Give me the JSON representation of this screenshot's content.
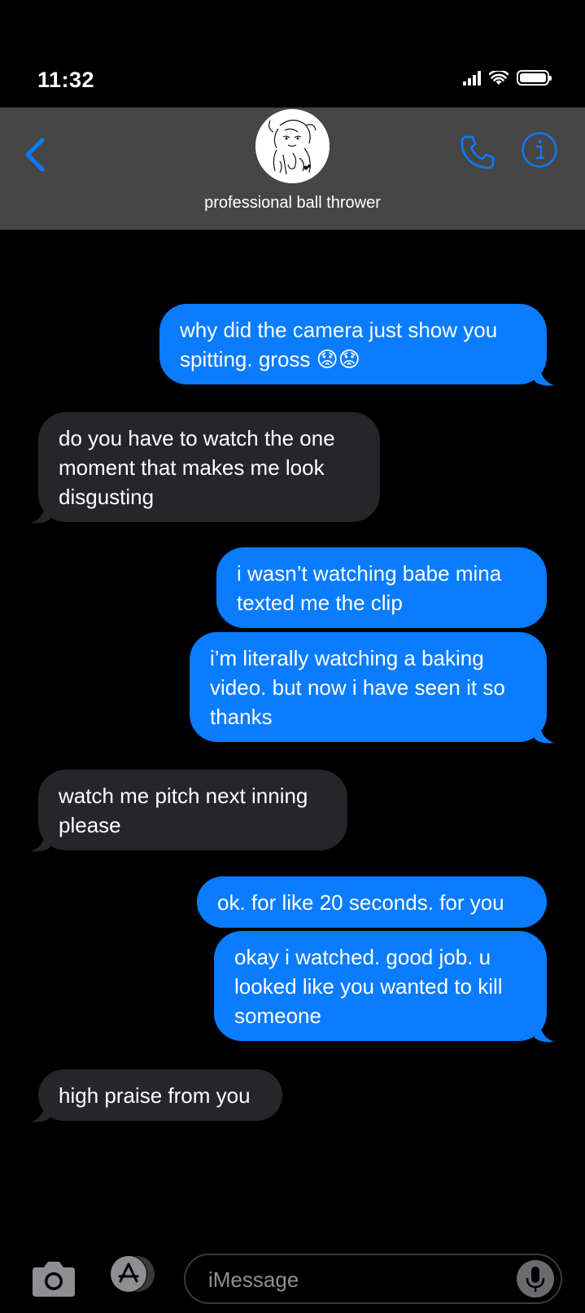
{
  "status_bar": {
    "time": "11:32"
  },
  "header": {
    "contact_name": "professional ball thrower",
    "avatar": "contact-avatar-sketch",
    "icons": [
      "chevron-left-icon",
      "phone-icon",
      "info-icon"
    ],
    "accent_color": "#0a7cff"
  },
  "messages": [
    {
      "direction": "sent",
      "text": "why did the camera just show you spitting. gross 😟😟"
    },
    {
      "direction": "received",
      "text": "do you have to watch the one moment that makes me look disgusting"
    },
    {
      "direction": "sent",
      "text": "i wasn’t watching babe mina texted me the clip"
    },
    {
      "direction": "sent",
      "text": "i’m literally watching a baking video. but now i have seen it so thanks"
    },
    {
      "direction": "received",
      "text": "watch me pitch next inning please"
    },
    {
      "direction": "sent",
      "text": "ok. for like 20 seconds. for you"
    },
    {
      "direction": "sent",
      "text": "okay i watched. good job. u looked like you wanted to kill someone"
    },
    {
      "direction": "received",
      "text": "high praise from you"
    }
  ],
  "composer": {
    "placeholder": "iMessage",
    "icons": [
      "camera-icon",
      "app-store-icon",
      "microphone-icon"
    ]
  },
  "colors": {
    "sent_bubble": "#0a7cff",
    "received_bubble": "#26252a",
    "header_bg": "#464646",
    "background": "#000000"
  }
}
